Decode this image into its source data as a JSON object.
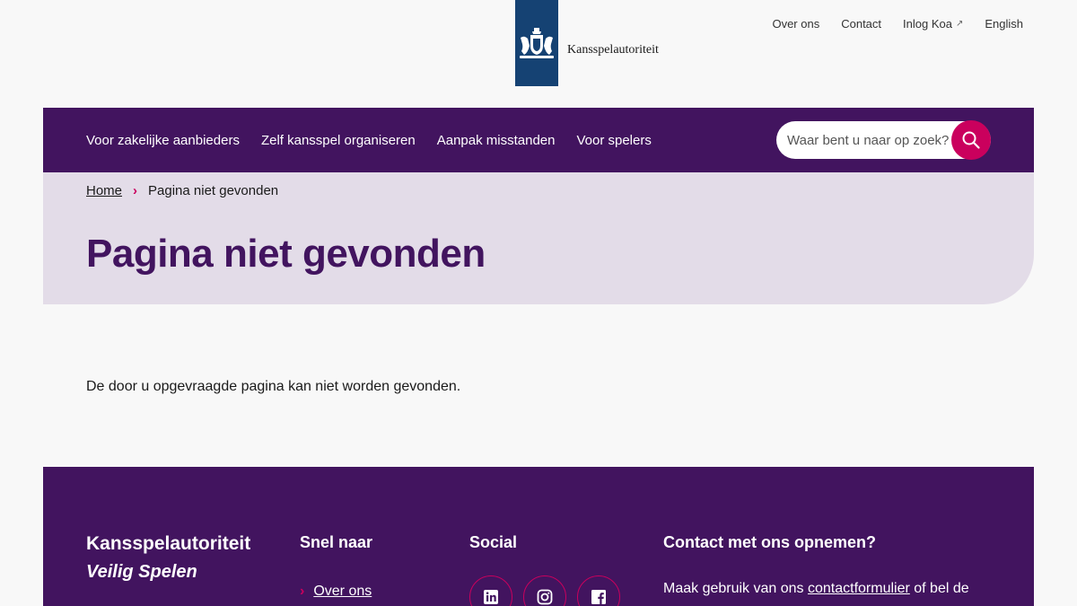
{
  "header": {
    "logo_wordmark": "Kansspelautoriteit",
    "top_links": [
      {
        "label": "Over ons"
      },
      {
        "label": "Contact"
      },
      {
        "label": "Inlog Koa",
        "external_icon": "external-link-icon"
      },
      {
        "label": "English"
      }
    ]
  },
  "nav": {
    "items": [
      {
        "label": "Voor zakelijke aanbieders"
      },
      {
        "label": "Zelf kansspel organiseren"
      },
      {
        "label": "Aanpak misstanden"
      },
      {
        "label": "Voor spelers"
      }
    ],
    "search": {
      "placeholder": "Waar bent u naar op zoek?",
      "icon": "search-icon"
    }
  },
  "breadcrumb": {
    "home": "Home",
    "current": "Pagina niet gevonden"
  },
  "page": {
    "title": "Pagina niet gevonden",
    "intro": "De door u opgevraagde pagina kan niet worden gevonden."
  },
  "footer": {
    "brand": "Kansspelautoriteit",
    "tagline": "Veilig Spelen",
    "snel_naar": {
      "heading": "Snel naar",
      "links": [
        {
          "label": "Over ons"
        }
      ]
    },
    "social": {
      "heading": "Social",
      "icons": [
        "linkedin-icon",
        "instagram-icon",
        "facebook-icon"
      ]
    },
    "contact": {
      "heading": "Contact met ons opnemen?",
      "text_before": "Maak gebruik van ons ",
      "link": "contactformulier",
      "text_after": " of bel de"
    }
  },
  "colors": {
    "brand_purple": "#42145f",
    "accent_pink": "#ca005d",
    "hero_lilac": "#e3dce8",
    "logo_blue": "#154273"
  }
}
